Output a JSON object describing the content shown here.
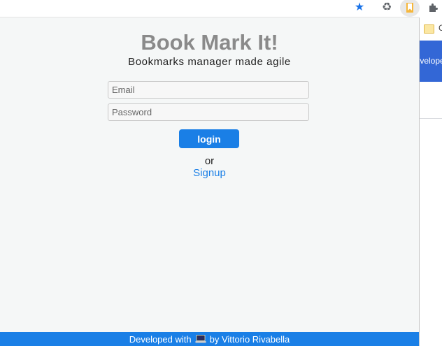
{
  "browser": {
    "icons": {
      "star": "star-icon",
      "recycle": "recycle-icon",
      "extension": "bookmark-extension-icon",
      "puzzle": "puzzle-icon"
    },
    "bg_folder_text": "C",
    "bg_banner_text": "Developers"
  },
  "popup": {
    "title": "Book Mark It!",
    "subtitle": "Bookmarks manager made agile",
    "email_placeholder": "Email",
    "password_placeholder": "Password",
    "login_label": "login",
    "or_text": "or",
    "signup_label": "Signup",
    "footer_prefix": "Developed with",
    "footer_icon": "laptop-icon",
    "footer_suffix": "by Vittorio Rivabella"
  },
  "colors": {
    "accent": "#1a7fe6",
    "title": "#8a8a8a",
    "background": "#f5f7f7"
  }
}
